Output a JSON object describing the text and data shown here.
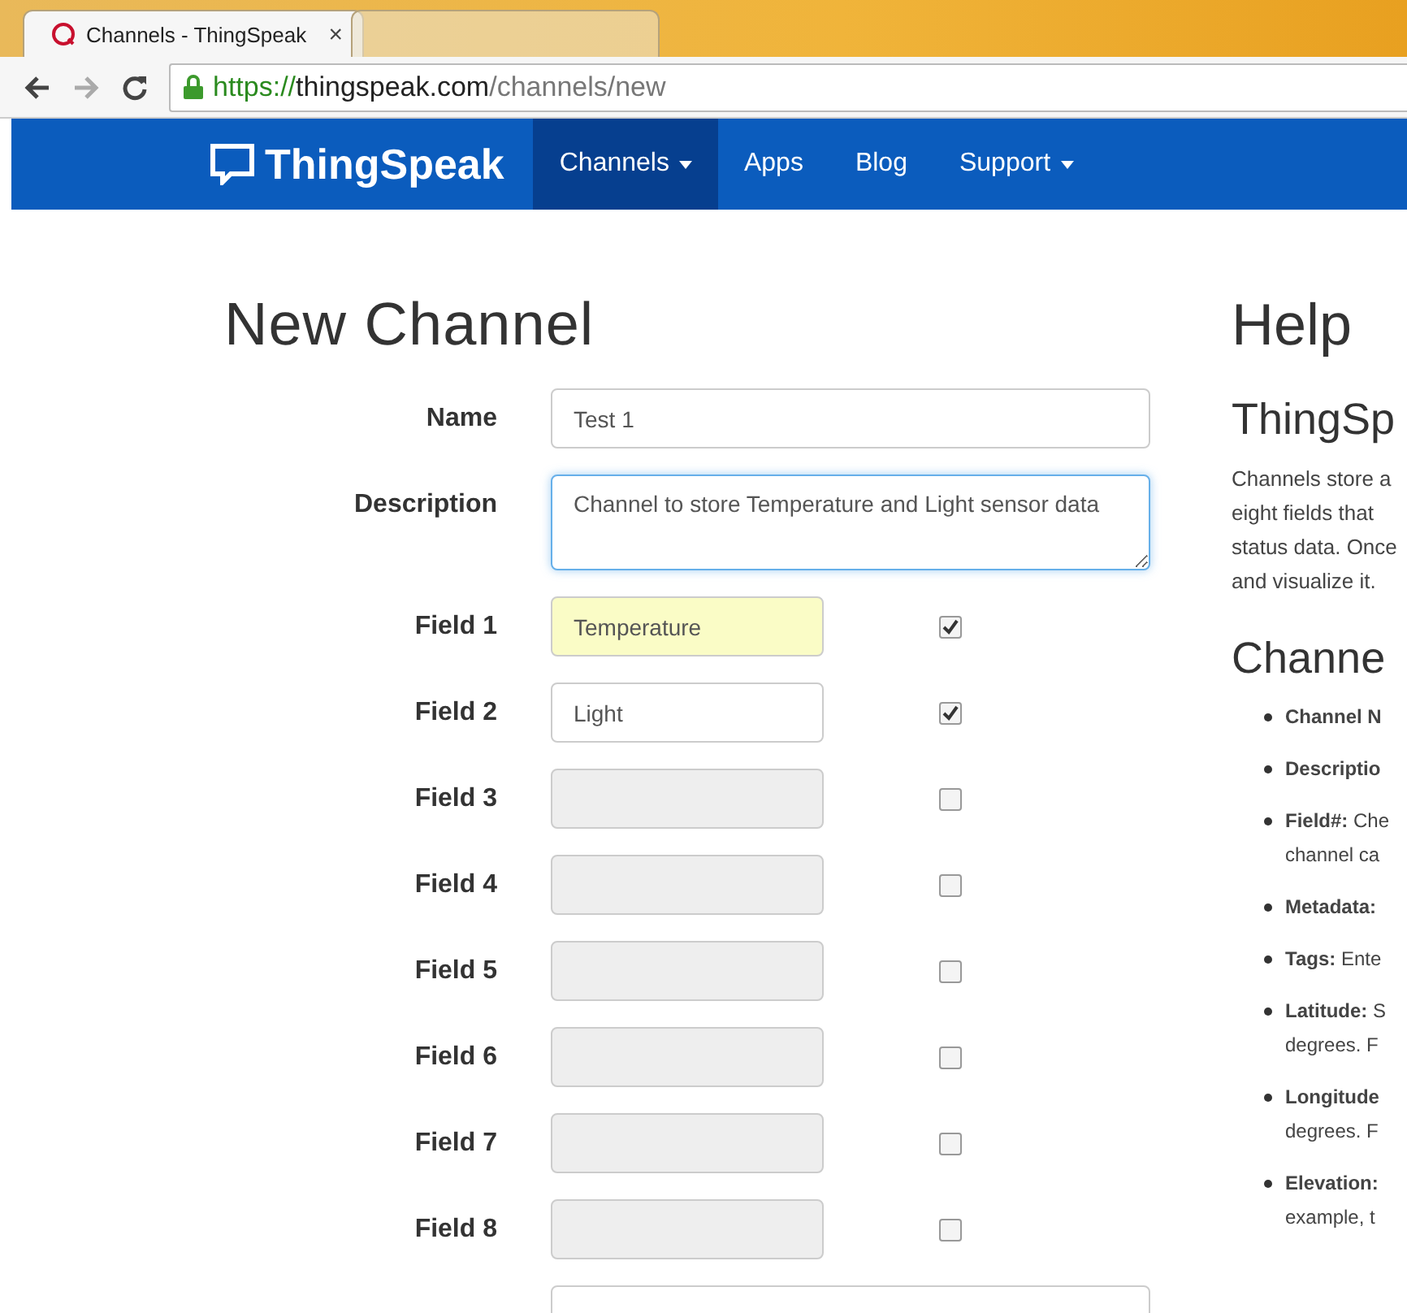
{
  "browser": {
    "tabs": [
      {
        "title": "Channels - ThingSpeak",
        "close": "×",
        "selected": true
      },
      {
        "selected": false
      }
    ],
    "address": {
      "scheme": "https://",
      "host": "thingspeak.com",
      "path": "/channels/new",
      "secure": true
    }
  },
  "nav": {
    "brand": "ThingSpeak",
    "items": [
      {
        "label": "Channels",
        "dropdown": true,
        "selected": true
      },
      {
        "label": "Apps",
        "dropdown": false,
        "selected": false
      },
      {
        "label": "Blog",
        "dropdown": false,
        "selected": false
      },
      {
        "label": "Support",
        "dropdown": true,
        "selected": false
      }
    ]
  },
  "form": {
    "title": "New Channel",
    "name": {
      "label": "Name",
      "value": "Test 1"
    },
    "description": {
      "label": "Description",
      "value": "Channel to store Temperature and Light sensor data",
      "focused": true
    },
    "fields": [
      {
        "label": "Field 1",
        "value": "Temperature",
        "checked": true,
        "disabled": false,
        "autofilled": true
      },
      {
        "label": "Field 2",
        "value": "Light",
        "checked": true,
        "disabled": false,
        "autofilled": false
      },
      {
        "label": "Field 3",
        "checked": false,
        "disabled": true,
        "autofilled": false
      },
      {
        "label": "Field 4",
        "checked": false,
        "disabled": true,
        "autofilled": false
      },
      {
        "label": "Field 5",
        "checked": false,
        "disabled": true,
        "autofilled": false
      },
      {
        "label": "Field 6",
        "checked": false,
        "disabled": true,
        "autofilled": false
      },
      {
        "label": "Field 7",
        "checked": false,
        "disabled": true,
        "autofilled": false
      },
      {
        "label": "Field 8",
        "checked": false,
        "disabled": true,
        "autofilled": false
      }
    ]
  },
  "help": {
    "title": "Help",
    "subtitle": "ThingSp",
    "intro": [
      "Channels store a",
      "eight fields that",
      "status data. Once",
      "and visualize it."
    ],
    "section": "Channe",
    "items": [
      {
        "lines": [
          "**Channel N**"
        ]
      },
      {
        "lines": [
          "**Descriptio**"
        ]
      },
      {
        "lines": [
          "**Field#:** Che",
          "channel ca"
        ]
      },
      {
        "lines": [
          "**Metadata:**"
        ]
      },
      {
        "lines": [
          "**Tags:** Ente"
        ]
      },
      {
        "lines": [
          "**Latitude:** S",
          "degrees. F"
        ]
      },
      {
        "lines": [
          "**Longitude**",
          "degrees. F"
        ]
      },
      {
        "lines": [
          "**Elevation:**",
          "example, t"
        ]
      }
    ]
  }
}
